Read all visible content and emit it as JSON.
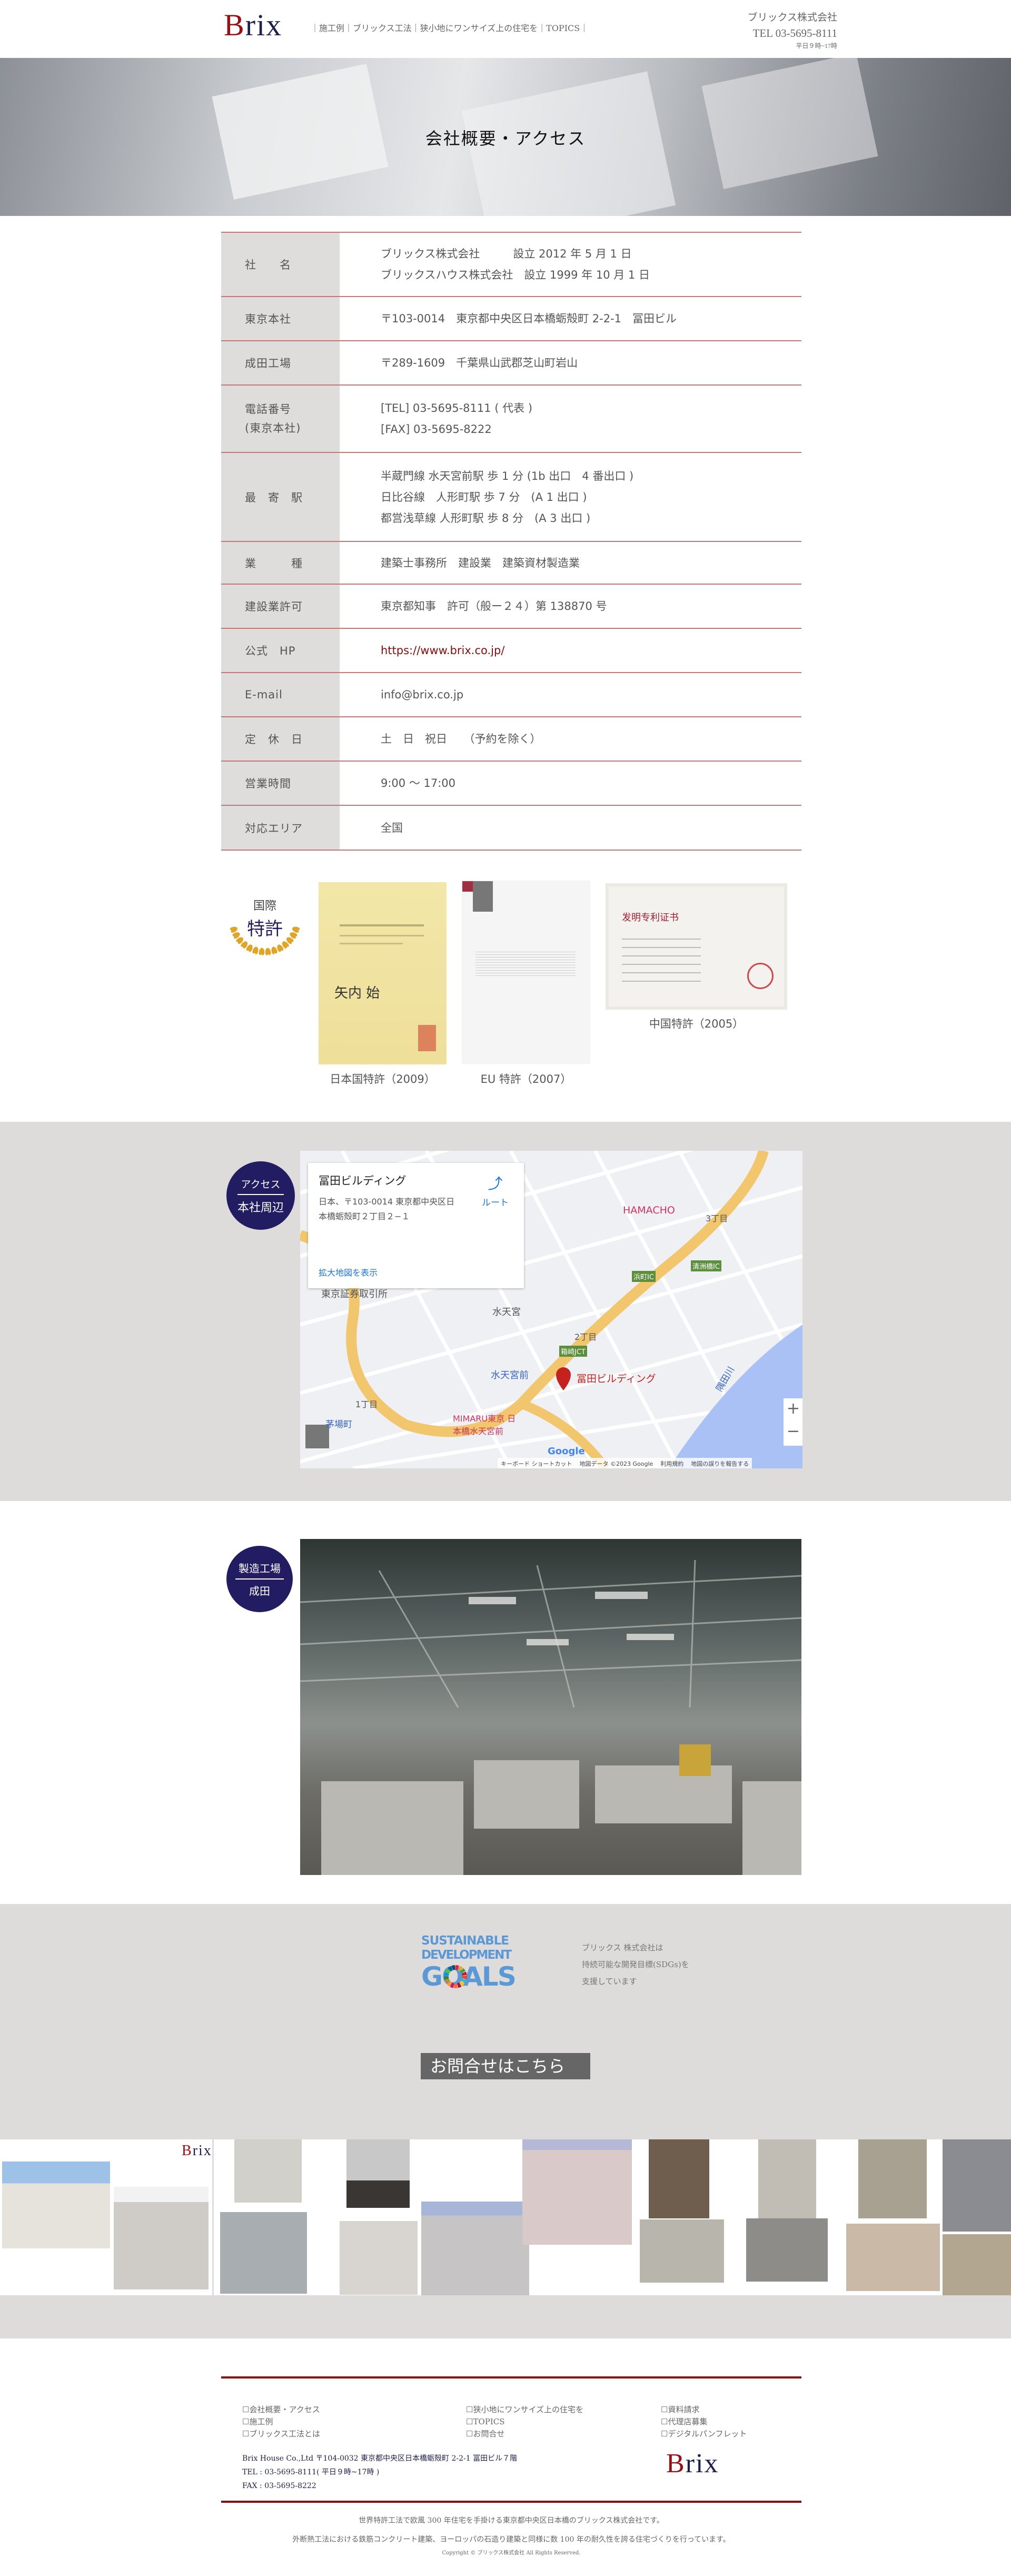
{
  "header": {
    "logo": "Brix",
    "nav": [
      "施工例",
      "ブリックス工法",
      "狭小地にワンサイズ上の住宅を",
      "TOPICS"
    ],
    "company": "ブリックス株式会社",
    "tel": "TEL 03-5695-8111",
    "hours": "平日９時~17時"
  },
  "hero": {
    "title": "会社概要・アクセス"
  },
  "company_table": [
    {
      "label": "社　　名",
      "lines": [
        "ブリックス株式会社　　　設立 2012 年 5 月 1 日",
        "ブリックスハウス株式会社　設立 1999 年 10 月 1 日"
      ]
    },
    {
      "label": "東京本社",
      "lines": [
        "〒103-0014　東京都中央区日本橋蛎殻町 2-2-1　冨田ビル"
      ]
    },
    {
      "label": "成田工場",
      "lines": [
        "〒289-1609　千葉県山武郡芝山町岩山"
      ]
    },
    {
      "label": "電話番号\n(東京本社)",
      "label_lines": [
        "電話番号",
        "(東京本社)"
      ],
      "lines": [
        "[TEL] 03-5695-8111 ( 代表 )",
        "[FAX] 03-5695-8222"
      ]
    },
    {
      "label": "最　寄　駅",
      "lines": [
        "半蔵門線 水天宮前駅 歩 1 分 (1b 出口　4 番出口 )",
        "日比谷線　人形町駅 歩 7 分　(A 1 出口 )",
        "都営浅草線 人形町駅 歩 8 分　(A 3 出口 )"
      ]
    },
    {
      "label": "業　　　種",
      "lines": [
        "建築士事務所　建設業　建築資材製造業"
      ]
    },
    {
      "label": "建設業許可",
      "lines": [
        "東京都知事　許可（般ー２４）第 138870 号"
      ]
    },
    {
      "label": "公式　HP",
      "link": "https://www.brix.co.jp/"
    },
    {
      "label": "E-mail",
      "lines": [
        "info@brix.co.jp"
      ]
    },
    {
      "label": "定　休　日",
      "lines": [
        "土　日　祝日　　（予約を除く）"
      ]
    },
    {
      "label": "営業時間",
      "lines": [
        "9:00 ～ 17:00"
      ]
    },
    {
      "label": "対応エリア",
      "lines": [
        "全国"
      ]
    }
  ],
  "patents": {
    "badge_top": "国際",
    "badge_bottom": "特許",
    "items": [
      {
        "caption": "日本国特許（2009）"
      },
      {
        "caption": "EU 特許（2007）"
      },
      {
        "caption": "中国特許（2005）"
      }
    ]
  },
  "access": {
    "badge_top": "アクセス",
    "badge_bottom": "本社周辺",
    "map": {
      "place_name": "冨田ビルディング",
      "address": "日本、〒103-0014 東京都中央区日本橋蛎殻町２丁目２−１",
      "route_label": "ルート",
      "larger_map_label": "拡大地図を表示",
      "pin_label": "冨田ビルディング",
      "labels": [
        "水天宮前",
        "水天宮",
        "東京証券取引所",
        "HAMACHO",
        "箱崎JCT",
        "浜町IC",
        "清洲橋IC",
        "隅田川",
        "MIMARU東京 日本橋水天宮前",
        "2丁目",
        "3丁目",
        "1丁目",
        "茅場町"
      ],
      "zoom_in": "+",
      "zoom_out": "−",
      "footer": [
        "キーボード ショートカット",
        "地図データ ©2023 Google",
        "利用規約",
        "地図の誤りを報告する"
      ],
      "google": "Google"
    }
  },
  "factory": {
    "badge_top": "製造工場",
    "badge_bottom": "成田"
  },
  "sdgs": {
    "logo_lines": [
      "SUSTAINABLE",
      "DEVELOPMENT",
      "GOALS"
    ],
    "text": [
      "ブリックス 株式会社は",
      "持続可能な開発目標(SDGs)を",
      "支援しています"
    ],
    "contact_button": "お問合せはこちら",
    "colors": [
      "#e5243b",
      "#dda63a",
      "#4c9f38",
      "#c5192d",
      "#ff3a21",
      "#26bde2",
      "#fcc30b",
      "#a21942",
      "#fd6925",
      "#dd1367",
      "#fd9d24",
      "#bf8b2e",
      "#3f7e44",
      "#0a97d9",
      "#56c02b",
      "#00689d",
      "#19486a"
    ]
  },
  "footer": {
    "links": [
      [
        "会社概要・アクセス",
        "施工例",
        "ブリックス工法とは"
      ],
      [
        "狭小地にワンサイズ上の住宅を",
        "TOPICS",
        "お問合せ"
      ],
      [
        "資料請求",
        "代理店募集",
        "デジタルパンフレット"
      ]
    ],
    "address": "Brix House Co.,Ltd  〒104-0032 東京都中央区日本橋蛎殻町 2-2-1 冨田ビル７階",
    "tel": "TEL : 03-5695-8111( 平日９時~17時 )",
    "fax": "FAX : 03-5695-8222",
    "logo": "Brix",
    "desc1": "世界特許工法で欧風 300 年住宅を手掛ける東京都中央区日本橋のブリックス株式会社です。",
    "desc2": "外断熱工法における鉄筋コンクリート建築、ヨーロッパの石造り建築と同様に数 100 年の耐久性を誇る住宅づくりを行っています。",
    "copyright": "Copyright © ブリックス株式会社 All Rights Reserved."
  },
  "colors": {
    "accent_red": "#9a0f14",
    "navy": "#221c63",
    "row_line": "#c07878",
    "gray_bg": "#dedbdb",
    "link_blue": "#1a73e8"
  }
}
